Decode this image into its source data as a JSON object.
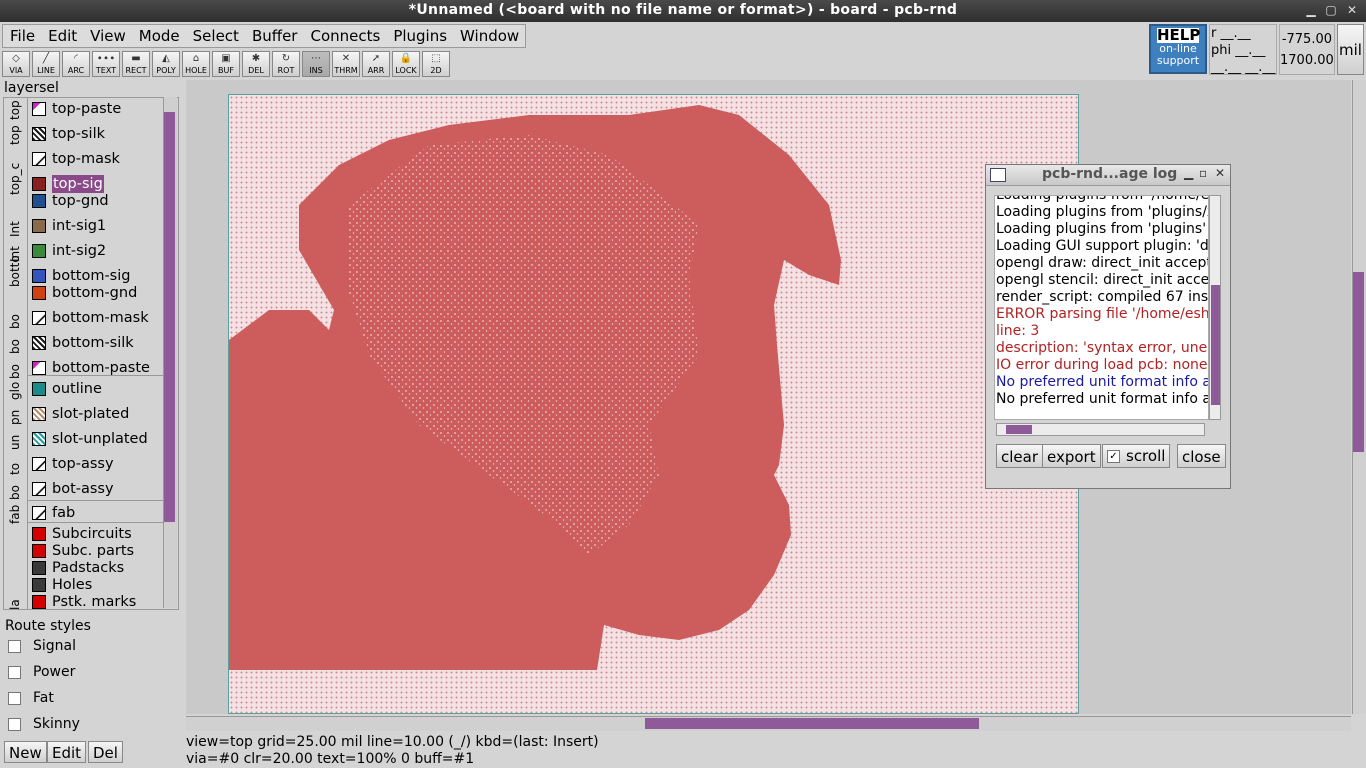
{
  "window": {
    "title": "*Unnamed (<board with no file name or format>) - board - pcb-rnd"
  },
  "menu": [
    "File",
    "Edit",
    "View",
    "Mode",
    "Select",
    "Buffer",
    "Connects",
    "Plugins",
    "Window"
  ],
  "toolbar": [
    {
      "label": "VIA",
      "icon": "via-icon",
      "glyph": "◇"
    },
    {
      "label": "LINE",
      "icon": "line-icon",
      "glyph": "╱"
    },
    {
      "label": "ARC",
      "icon": "arc-icon",
      "glyph": "◜"
    },
    {
      "label": "TEXT",
      "icon": "text-icon",
      "glyph": "∙∙∙"
    },
    {
      "label": "RECT",
      "icon": "rect-icon",
      "glyph": "▬"
    },
    {
      "label": "POLY",
      "icon": "poly-icon",
      "glyph": "◭"
    },
    {
      "label": "HOLE",
      "icon": "hole-icon",
      "glyph": "⌂"
    },
    {
      "label": "BUF",
      "icon": "buffer-icon",
      "glyph": "▣"
    },
    {
      "label": "DEL",
      "icon": "delete-icon",
      "glyph": "✱"
    },
    {
      "label": "ROT",
      "icon": "rotate-icon",
      "glyph": "↻"
    },
    {
      "label": "INS",
      "icon": "insert-icon",
      "glyph": "⋯"
    },
    {
      "label": "THRM",
      "icon": "thermal-icon",
      "glyph": "✕"
    },
    {
      "label": "ARR",
      "icon": "arrow-icon",
      "glyph": "➚"
    },
    {
      "label": "LOCK",
      "icon": "lock-icon",
      "glyph": "🔒"
    },
    {
      "label": "2D",
      "icon": "2d-icon",
      "glyph": "⬚"
    }
  ],
  "active_tool": "INS",
  "help": {
    "title": "HELP",
    "line1": "on-line",
    "line2": "support"
  },
  "coords": {
    "r": "r __.__",
    "phi": "phi __.__",
    "blank": "__.__ __.__",
    "x": "-775.00",
    "y": "1700.00",
    "unit": "mil"
  },
  "layersel": {
    "title": "layersel",
    "groups": [
      "top",
      "top",
      "top_c",
      "Int",
      "Int",
      "botto",
      "bo",
      "bo",
      "bo",
      "glo",
      "pn",
      "un",
      "to",
      "bo",
      "fab",
      "la"
    ],
    "layers": [
      {
        "name": "top-paste",
        "color": "#e8e8e8",
        "pattern": "paste"
      },
      {
        "name": "top-silk",
        "color": "#1a1a1a",
        "pattern": "hatch"
      },
      {
        "name": "top-mask",
        "color": "#eeeeee",
        "pattern": "mask"
      },
      {
        "name": "top-sig",
        "color": "#8b2020",
        "pattern": "solid"
      },
      {
        "name": "top-gnd",
        "color": "#1f4f8f",
        "pattern": "solid"
      },
      {
        "name": "int-sig1",
        "color": "#8a6a4a",
        "pattern": "solid"
      },
      {
        "name": "int-sig2",
        "color": "#3a8a3a",
        "pattern": "solid"
      },
      {
        "name": "bottom-sig",
        "color": "#3355bb",
        "pattern": "solid"
      },
      {
        "name": "bottom-gnd",
        "color": "#d04010",
        "pattern": "solid"
      },
      {
        "name": "bottom-mask",
        "color": "#eeeeee",
        "pattern": "mask"
      },
      {
        "name": "bottom-silk",
        "color": "#1a1a1a",
        "pattern": "hatch"
      },
      {
        "name": "bottom-paste",
        "color": "#e8e8e8",
        "pattern": "paste"
      },
      {
        "name": "outline",
        "color": "#1a8a8a",
        "pattern": "solid"
      },
      {
        "name": "slot-plated",
        "color": "#b09070",
        "pattern": "hatch"
      },
      {
        "name": "slot-unplated",
        "color": "#20a0a0",
        "pattern": "hatch"
      },
      {
        "name": "top-assy",
        "color": "#eeeeee",
        "pattern": "mask"
      },
      {
        "name": "bot-assy",
        "color": "#eeeeee",
        "pattern": "mask"
      },
      {
        "name": "fab",
        "color": "#eeeeee",
        "pattern": "mask"
      }
    ],
    "selected": "top-sig",
    "ui_layers": [
      {
        "name": "Subcircuits",
        "color": "#d40000"
      },
      {
        "name": "Subc. parts",
        "color": "#d40000"
      },
      {
        "name": "Padstacks",
        "color": "#3a3a3a"
      },
      {
        "name": "Holes",
        "color": "#3a3a3a"
      },
      {
        "name": "Pstk. marks",
        "color": "#d40000"
      }
    ]
  },
  "route_styles": {
    "title": "Route styles",
    "items": [
      "Signal",
      "Power",
      "Fat",
      "Skinny"
    ],
    "buttons": {
      "new": "New",
      "edit": "Edit",
      "del": "Del"
    }
  },
  "status": {
    "line1": "view=top  grid=25.00 mil  line=10.00 (_/) kbd=(last: Insert)",
    "line2": "via=#0  clr=20.00  text=100% 0 buff=#1"
  },
  "log": {
    "title": "pcb-rnd...age log",
    "lines": [
      {
        "text": "Loading plugins from '/home/e",
        "cls": ""
      },
      {
        "text": "Loading plugins from 'plugins/x",
        "cls": ""
      },
      {
        "text": "Loading plugins from 'plugins'",
        "cls": ""
      },
      {
        "text": "Loading GUI support plugin: 'dia",
        "cls": ""
      },
      {
        "text": "opengl draw: direct_init accept",
        "cls": ""
      },
      {
        "text": "opengl stencil: direct_init accep",
        "cls": ""
      },
      {
        "text": "render_script: compiled 67 inst",
        "cls": ""
      },
      {
        "text": "ERROR parsing file '/home/esh/",
        "cls": "err"
      },
      {
        "text": "   line:       3",
        "cls": "err"
      },
      {
        "text": "   description: 'syntax error, une",
        "cls": "err"
      },
      {
        "text": "IO error during load pcb: none c",
        "cls": "err"
      },
      {
        "text": "No preferred unit format info a",
        "cls": "info"
      },
      {
        "text": "No preferred unit format info a",
        "cls": ""
      }
    ],
    "buttons": {
      "clear": "clear",
      "export": "export",
      "scroll": "scroll",
      "close": "close"
    },
    "scroll_checked": true
  },
  "colors": {
    "accent": "#8e5a9a",
    "board_fill": "#cd5c5c",
    "board_bg": "#f5e1e3"
  }
}
